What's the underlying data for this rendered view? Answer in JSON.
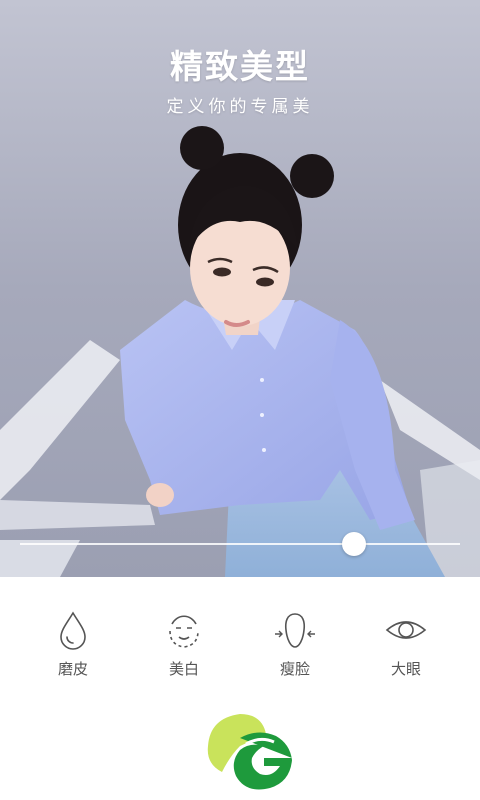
{
  "hero": {
    "title": "精致美型",
    "subtitle": "定义你的专属美"
  },
  "slider": {
    "level": 0.77
  },
  "tools": [
    {
      "label": "磨皮",
      "icon": "droplet-icon"
    },
    {
      "label": "美白",
      "icon": "face-smile-icon"
    },
    {
      "label": "瘦脸",
      "icon": "face-slim-icon"
    },
    {
      "label": "大眼",
      "icon": "eye-icon"
    }
  ],
  "brand": {
    "logo_icon": "g-leaf-logo",
    "colors": {
      "green": "#1e9a3c",
      "lime": "#c9e35b"
    }
  }
}
